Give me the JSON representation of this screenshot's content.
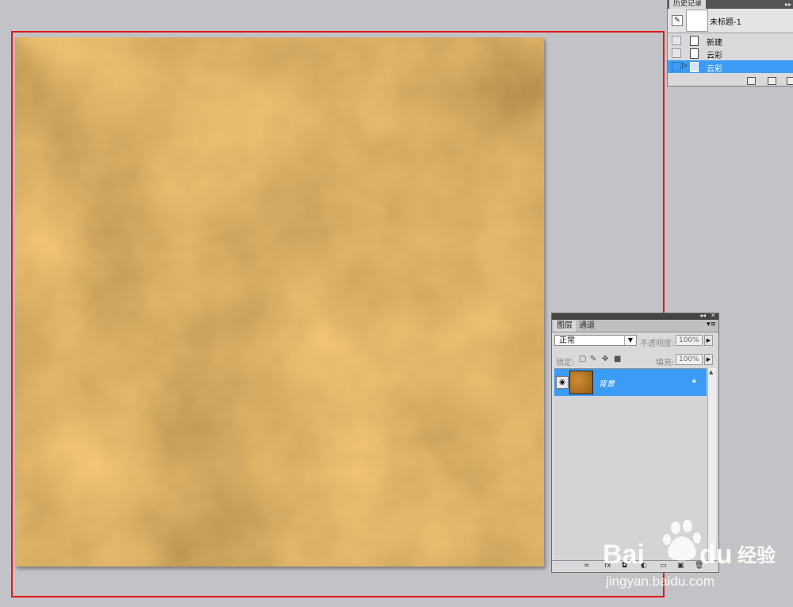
{
  "history_panel": {
    "tab_label": "历史记录",
    "collapse_glyph": "▸▸",
    "snapshot_label": "未标题-1",
    "states": [
      {
        "label": "新建",
        "selected": false
      },
      {
        "label": "云彩",
        "selected": false
      },
      {
        "label": "云彩",
        "selected": true
      }
    ],
    "selection_color": "#3c9cf5"
  },
  "canvas": {
    "fill_color": "#b67a24",
    "texture": "clouds",
    "highlight_color": "#e01818"
  },
  "layers_panel": {
    "tabs": [
      "图层",
      "通道"
    ],
    "blend_mode": "正常",
    "opacity_label": "不透明度:",
    "opacity_value": "100%",
    "lock_label": "锁定:",
    "fill_label": "填充:",
    "fill_value": "100%",
    "layer_name": "背景"
  },
  "watermark": {
    "brand": "Bai",
    "brand_tail": "du",
    "product": "经验",
    "url": "jingyan.baidu.com"
  }
}
